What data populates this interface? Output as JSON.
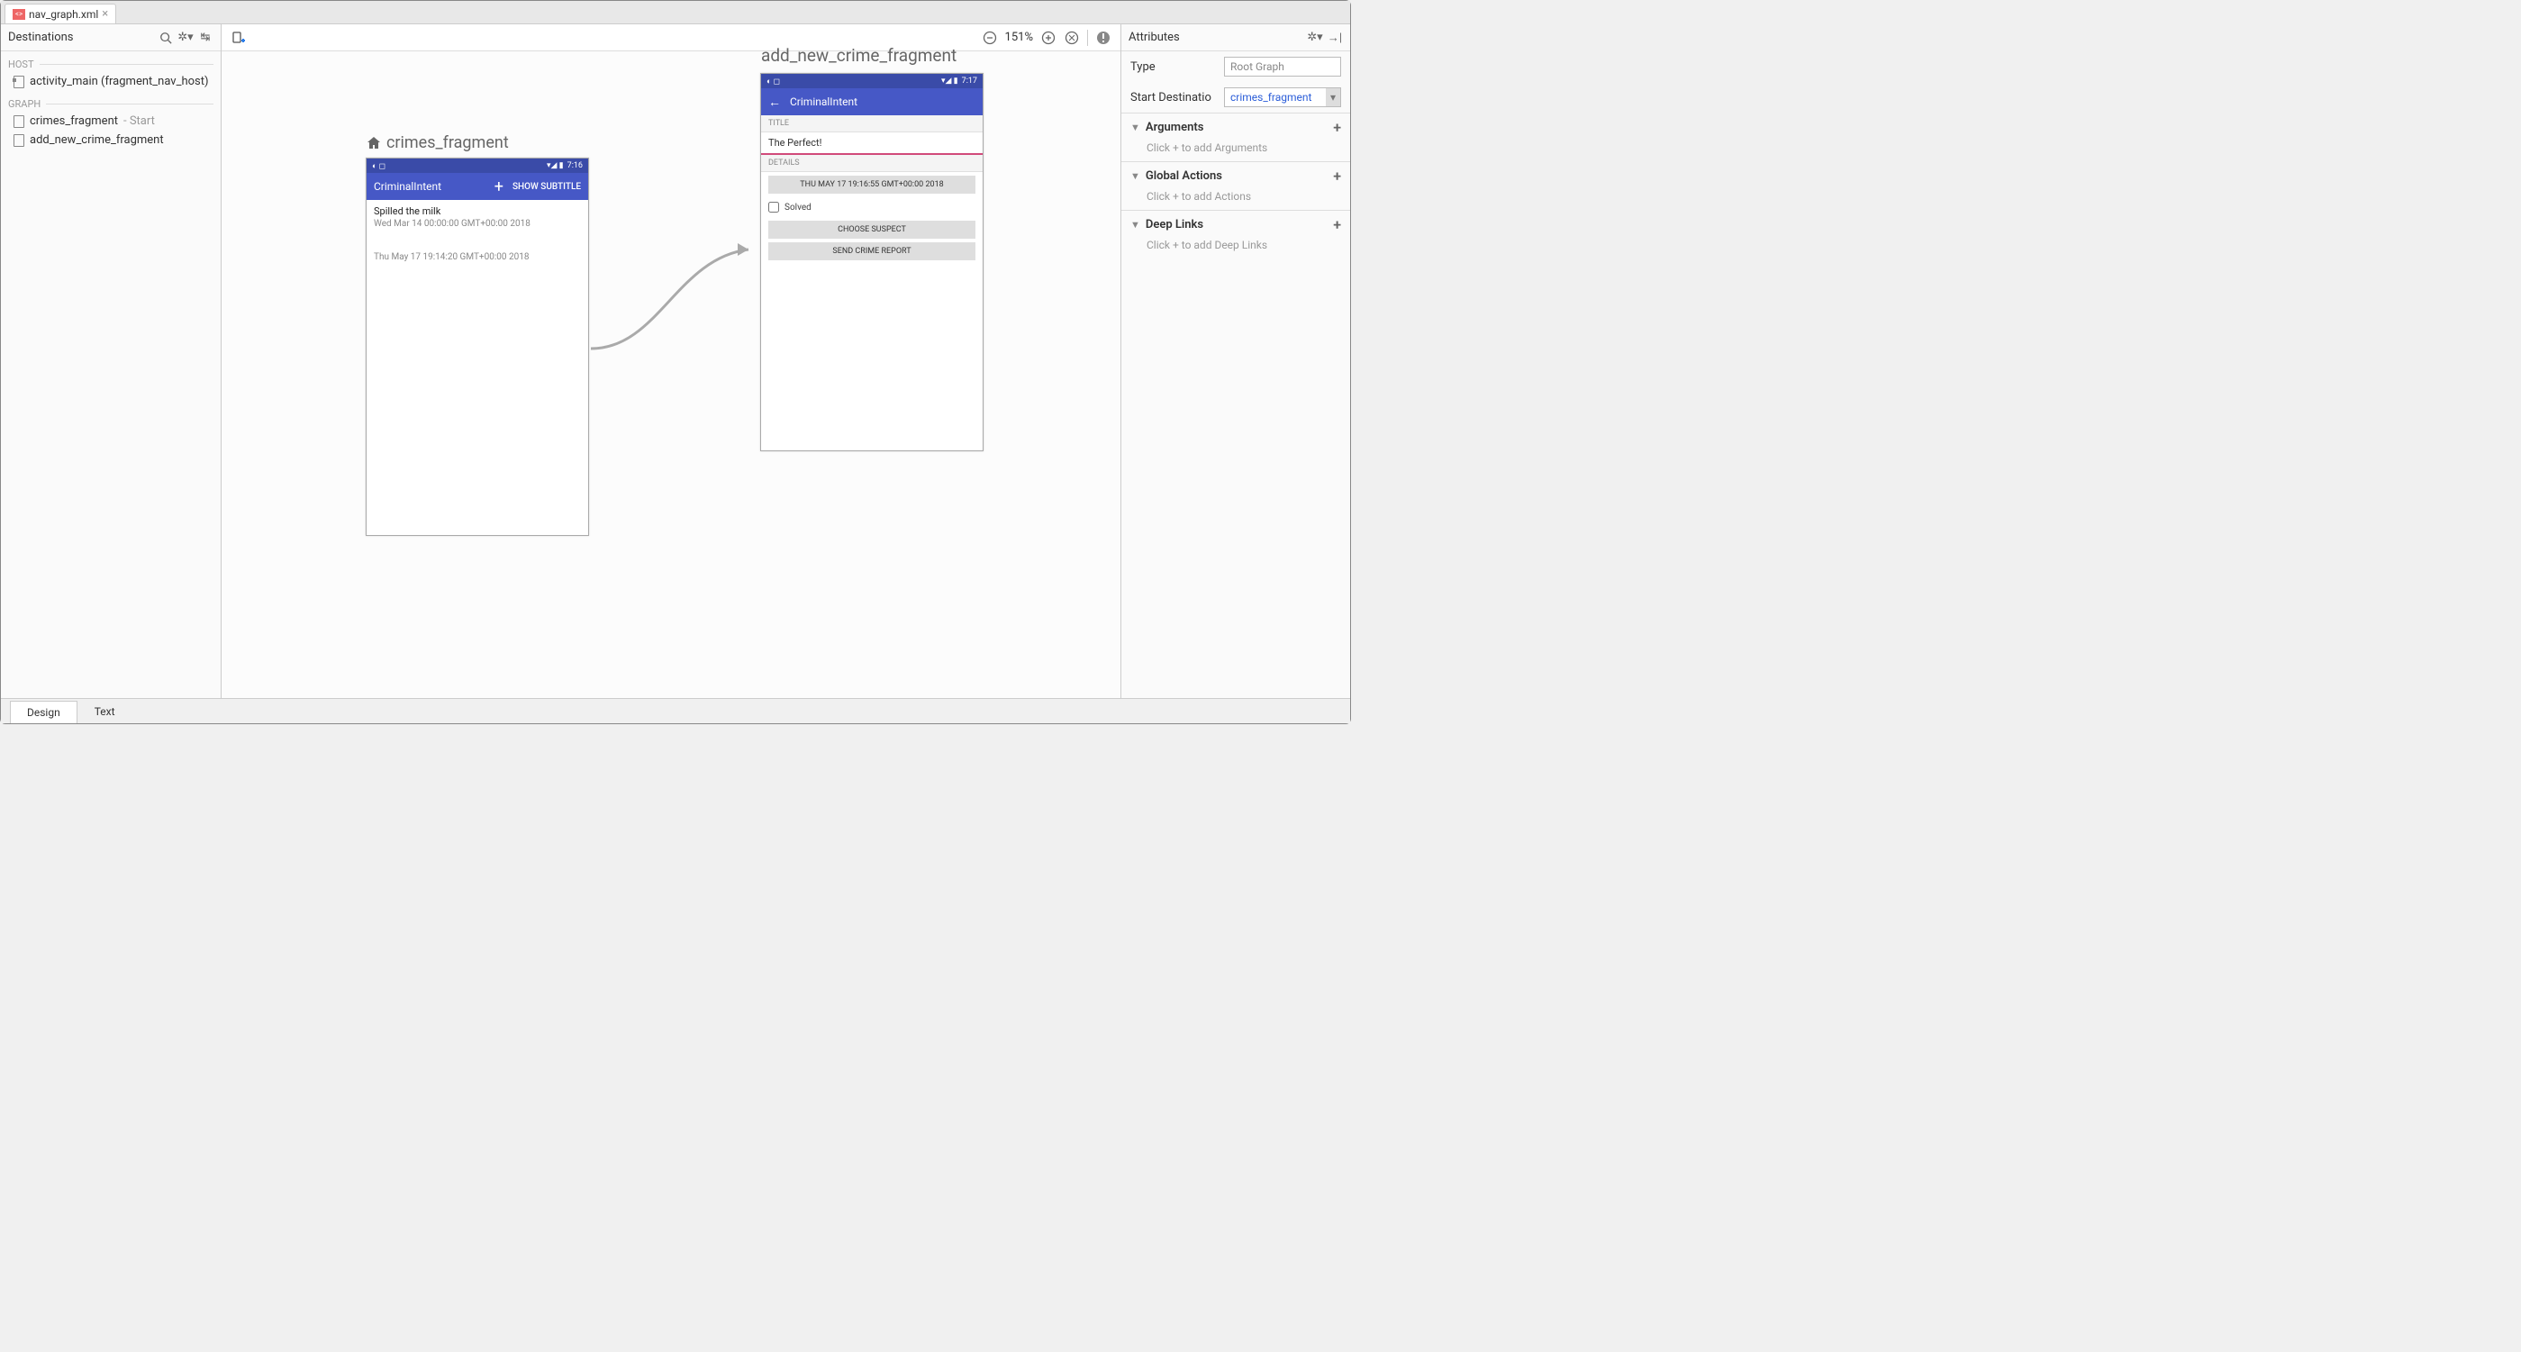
{
  "file_tab": {
    "name": "nav_graph.xml"
  },
  "destinations_panel": {
    "title": "Destinations",
    "host_section": "HOST",
    "host_item": "activity_main (fragment_nav_host)",
    "graph_section": "GRAPH",
    "items": [
      {
        "name": "crimes_fragment",
        "suffix": " - Start"
      },
      {
        "name": "add_new_crime_fragment",
        "suffix": ""
      }
    ]
  },
  "canvas": {
    "zoom": "151%",
    "crimes_label": "crimes_fragment",
    "add_new_label": "add_new_crime_fragment",
    "crimes_phone": {
      "time": "7:16",
      "app_title": "CriminalIntent",
      "show_subtitle": "SHOW SUBTITLE",
      "rows": [
        {
          "title": "Spilled the milk",
          "subtitle": "Wed Mar 14 00:00:00 GMT+00:00 2018"
        },
        {
          "title": "",
          "subtitle": "Thu May 17 19:14:20 GMT+00:00 2018"
        }
      ]
    },
    "add_phone": {
      "time": "7:17",
      "app_title": "CriminalIntent",
      "title_section": "TITLE",
      "title_value": "The Perfect!",
      "details_section": "DETAILS",
      "date_btn": "THU MAY 17 19:16:55 GMT+00:00 2018",
      "solved_label": "Solved",
      "choose_suspect": "CHOOSE SUSPECT",
      "send_report": "SEND CRIME REPORT"
    }
  },
  "attributes_panel": {
    "title": "Attributes",
    "type_label": "Type",
    "type_value": "Root Graph",
    "start_dest_label": "Start Destination",
    "start_dest_value": "crimes_fragment",
    "sections": {
      "arguments": {
        "title": "Arguments",
        "hint": "Click + to add Arguments"
      },
      "global_actions": {
        "title": "Global Actions",
        "hint": "Click + to add Actions"
      },
      "deep_links": {
        "title": "Deep Links",
        "hint": "Click + to add Deep Links"
      }
    }
  },
  "bottom_tabs": {
    "design": "Design",
    "text": "Text"
  }
}
